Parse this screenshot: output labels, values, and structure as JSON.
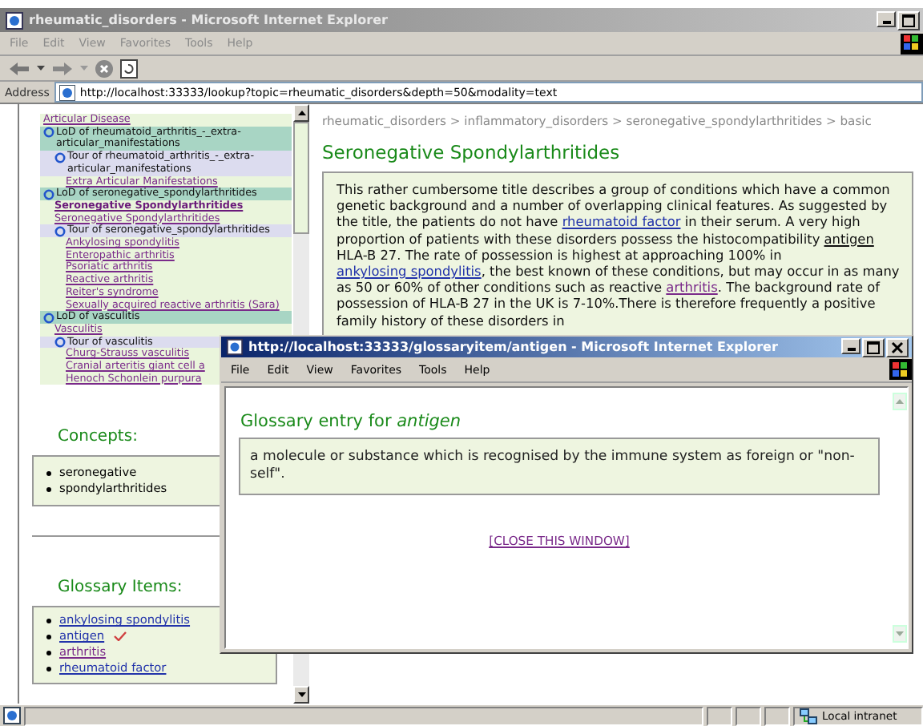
{
  "window": {
    "title": "rheumatic_disorders - Microsoft Internet Explorer"
  },
  "menu": [
    "File",
    "Edit",
    "View",
    "Favorites",
    "Tools",
    "Help"
  ],
  "address": {
    "label": "Address",
    "value": "http://localhost:33333/lookup?topic=rheumatic_disorders&depth=50&modality=text"
  },
  "tree": [
    {
      "kind": "link",
      "label": "Articular Disease",
      "selected": false
    },
    {
      "kind": "lod",
      "label": "LoD of rheumatoid_arthritis_-_extra-articular_manifestations",
      "children": [
        {
          "kind": "tour",
          "label": "Tour of rheumatoid_arthritis_-_extra-articular_manifestations",
          "children": [
            {
              "kind": "link",
              "label": "Extra Articular Manifestations",
              "selected": false
            }
          ]
        }
      ]
    },
    {
      "kind": "lod",
      "label": "LoD of seronegative_spondylarthritides",
      "children": [
        {
          "kind": "link",
          "label": "Seronegative Spondylarthritides",
          "selected": true
        },
        {
          "kind": "link",
          "label": "Seronegative Spondylarthritides",
          "selected": false
        },
        {
          "kind": "tour",
          "label": "Tour of seronegative_spondylarthritides",
          "children": [
            {
              "kind": "link",
              "label": "Ankylosing spondylitis",
              "selected": false
            },
            {
              "kind": "link",
              "label": "Enteropathic arthritis",
              "selected": false
            },
            {
              "kind": "link",
              "label": "Psoriatic arthritis",
              "selected": false
            },
            {
              "kind": "link",
              "label": "Reactive arthritis",
              "selected": false
            },
            {
              "kind": "link",
              "label": "Reiter's syndrome",
              "selected": false
            },
            {
              "kind": "link",
              "label": "Sexually acquired reactive arthritis (Sara)",
              "selected": false
            }
          ]
        }
      ]
    },
    {
      "kind": "lod",
      "label": "LoD of vasculitis",
      "children": [
        {
          "kind": "link",
          "label": "Vasculitis",
          "selected": false
        },
        {
          "kind": "tour",
          "label": "Tour of vasculitis",
          "children": [
            {
              "kind": "link",
              "label": "Churg-Strauss vasculitis",
              "selected": false
            },
            {
              "kind": "link",
              "label": "Cranial arteritis giant cell a",
              "selected": false
            },
            {
              "kind": "link",
              "label": "Henoch Schonlein purpura",
              "selected": false
            }
          ]
        }
      ]
    }
  ],
  "concepts": {
    "heading": "Concepts:",
    "items": [
      "seronegative",
      "spondylarthritides"
    ]
  },
  "glossary": {
    "heading": "Glossary Items:",
    "items": [
      {
        "label": "ankylosing spondylitis",
        "visited": false,
        "checked": false
      },
      {
        "label": "antigen",
        "visited": false,
        "checked": true
      },
      {
        "label": "arthritis",
        "visited": true,
        "checked": false
      },
      {
        "label": "rheumatoid factor",
        "visited": false,
        "checked": false
      }
    ]
  },
  "breadcrumb": "rheumatic_disorders > inflammatory_disorders > seronegative_spondylarthritides > basic",
  "heading": "Seronegative Spondylarthritides",
  "paragraph": [
    {
      "kind": "text",
      "text": "This rather cumbersome title describes a group of conditions which have a common genetic background and a number of overlapping clinical features. As suggested by the title, the patients do not have "
    },
    {
      "kind": "link",
      "text": "rheumatoid factor",
      "visited": false
    },
    {
      "kind": "text",
      "text": " in their serum. A very high proportion of patients with these disorders possess the histocompatibility "
    },
    {
      "kind": "term",
      "text": "antigen"
    },
    {
      "kind": "text",
      "text": " HLA-B 27. The rate of possession is highest at approaching 100% in "
    },
    {
      "kind": "link",
      "text": "ankylosing spondylitis",
      "visited": false
    },
    {
      "kind": "text",
      "text": ", the best known of these conditions, but may occur in as many as 50 or 60% of other conditions such as reactive "
    },
    {
      "kind": "link",
      "text": "arthritis",
      "visited": true
    },
    {
      "kind": "text",
      "text": ". The background rate of possession of HLA-B 27 in the UK is 7-10%.There is therefore frequently a positive family history of these disorders in"
    }
  ],
  "popup": {
    "title": "http://localhost:33333/glossaryitem/antigen - Microsoft Internet Explorer",
    "menu": [
      "File",
      "Edit",
      "View",
      "Favorites",
      "Tools",
      "Help"
    ],
    "heading": "Glossary entry for *antigen*",
    "definition": "a molecule or substance which is recognised by the immune system as foreign or \"non-self\".",
    "close_link": "[CLOSE THIS WINDOW]"
  },
  "status_bar": {
    "zone": "Local intranet"
  }
}
